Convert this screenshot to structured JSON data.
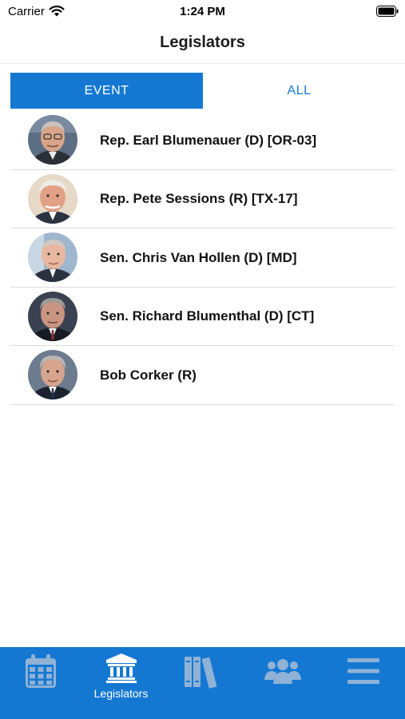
{
  "status_bar": {
    "carrier": "Carrier",
    "time": "1:24 PM"
  },
  "nav": {
    "title": "Legislators"
  },
  "segments": {
    "event": "EVENT",
    "all": "ALL",
    "selected": "EVENT"
  },
  "legislators": [
    {
      "name": "Rep. Earl Blumenauer (D) [OR-03]"
    },
    {
      "name": "Rep. Pete Sessions (R) [TX-17]"
    },
    {
      "name": "Sen. Chris Van Hollen (D) [MD]"
    },
    {
      "name": "Sen. Richard Blumenthal (D) [CT]"
    },
    {
      "name": "Bob Corker (R)"
    }
  ],
  "tab_bar": {
    "tabs": [
      {
        "icon": "calendar-icon",
        "label": ""
      },
      {
        "icon": "capitol-building-icon",
        "label": "Legislators",
        "active": true
      },
      {
        "icon": "books-icon",
        "label": ""
      },
      {
        "icon": "group-icon",
        "label": ""
      },
      {
        "icon": "menu-icon",
        "label": ""
      }
    ]
  },
  "colors": {
    "accent": "#1478d2",
    "tab_inactive": "#8fb2d6",
    "tab_active": "#ffffff"
  }
}
